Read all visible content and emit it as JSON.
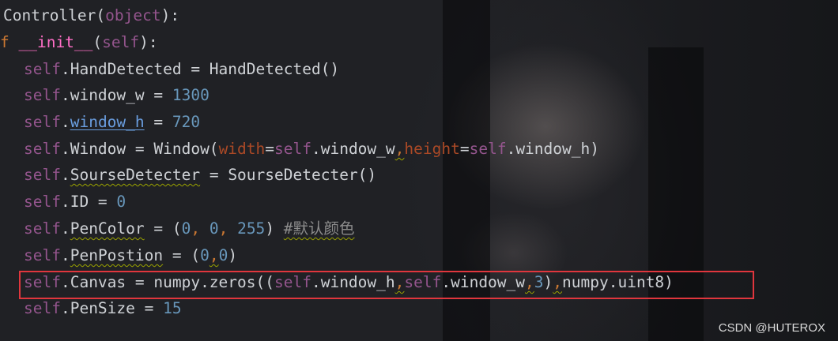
{
  "code_lines": [
    {
      "seg": [
        "Controller(",
        "object",
        "):"
      ]
    },
    {
      "seg": [
        "f ",
        "__init__",
        "(",
        "self",
        "):"
      ]
    },
    {
      "seg": [
        "self",
        ".HandDetected = HandDetected()"
      ]
    },
    {
      "seg": [
        "self",
        ".window_w = ",
        "1300"
      ]
    },
    {
      "seg": [
        "self",
        ".",
        "window_h",
        " = ",
        "720"
      ]
    },
    {
      "seg": [
        "self",
        ".Window = Window(",
        "width",
        "=",
        "self",
        ".window_w",
        ",",
        "height",
        "=",
        "self",
        ".window_h)"
      ]
    },
    {
      "seg": [
        "self",
        ".",
        "SourseDetecter",
        " = SourseDetecter()"
      ]
    },
    {
      "seg": [
        "self",
        ".ID = ",
        "0"
      ]
    },
    {
      "seg": [
        "self",
        ".",
        "PenColor",
        " = (",
        "0",
        ", ",
        "0",
        ", ",
        "255",
        ") ",
        "#默认颜色"
      ]
    },
    {
      "seg": [
        "self",
        ".",
        "PenPostion",
        " = (",
        "0",
        ",",
        "0",
        ")"
      ]
    },
    {
      "seg": [
        "self",
        ".Canvas = numpy.zeros((",
        "self",
        ".window_h",
        ",",
        "self",
        ".window_w",
        ",",
        "3",
        ")",
        ",",
        "numpy.uint8)"
      ]
    },
    {
      "seg": [
        "self",
        ".PenSize = ",
        "15"
      ]
    }
  ],
  "watermark": "CSDN @HUTEROX",
  "colors": {
    "keyword": "#cc7832",
    "self": "#94558d",
    "number": "#6897bb",
    "highlight_box": "#e0363d"
  }
}
